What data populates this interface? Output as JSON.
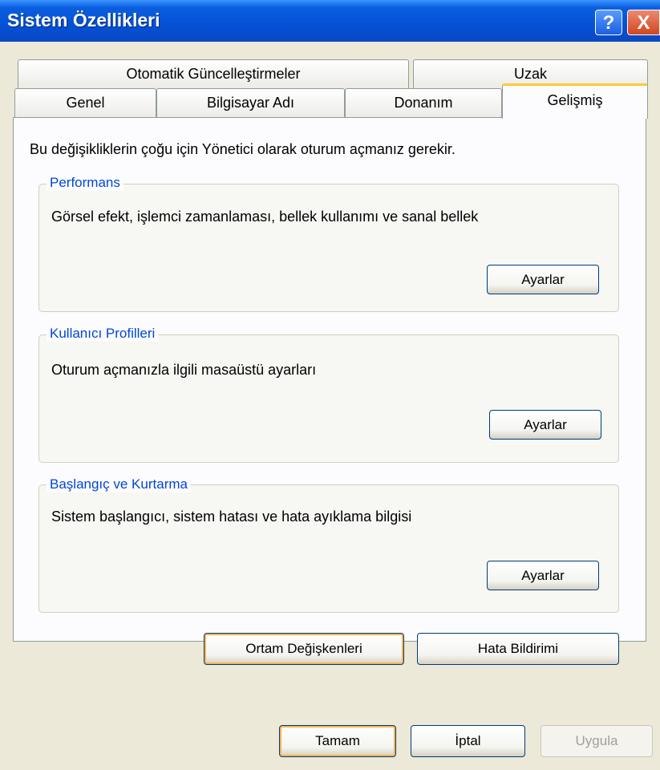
{
  "window": {
    "title": "Sistem Özellikleri",
    "help_glyph": "?",
    "close_glyph": "X"
  },
  "tabs": {
    "top_row": [
      "Otomatik Güncelleştirmeler",
      "Uzak"
    ],
    "bottom_row": [
      "Genel",
      "Bilgisayar Adı",
      "Donanım",
      "Gelişmiş"
    ],
    "active": "Gelişmiş"
  },
  "intro": "Bu değişikliklerin çoğu için Yönetici olarak oturum açmanız gerekir.",
  "groups": [
    {
      "title": "Performans",
      "desc": "Görsel efekt, işlemci zamanlaması, bellek kullanımı ve sanal bellek",
      "button": "Ayarlar"
    },
    {
      "title": "Kullanıcı Profilleri",
      "desc": "Oturum açmanızla ilgili masaüstü ayarları",
      "button": "Ayarlar"
    },
    {
      "title": "Başlangıç ve Kurtarma",
      "desc": "Sistem başlangıcı, sistem hatası ve hata ayıklama bilgisi",
      "button": "Ayarlar"
    }
  ],
  "panel_buttons": {
    "env": "Ortam Değişkenleri",
    "error": "Hata Bildirimi"
  },
  "dialog_buttons": {
    "ok": "Tamam",
    "cancel": "İptal",
    "apply": "Uygula"
  },
  "colors": {
    "title_bar": "#0551d6",
    "group_title": "#0046d5",
    "active_tab_highlight": "#ffc83c",
    "dialog_bg": "#ece9d8"
  }
}
